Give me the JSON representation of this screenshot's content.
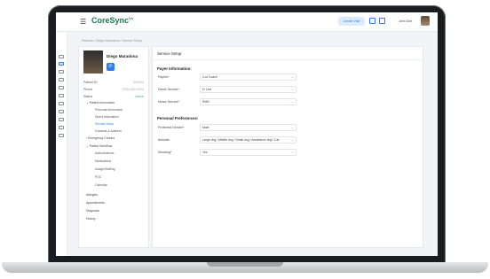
{
  "app": {
    "logo": "CoreSync",
    "logo_sup": "Vs"
  },
  "topbar": {
    "menu_icon": "hamburger-icon",
    "create_label": "Create Visit",
    "user_name": "John Doe"
  },
  "breadcrumb": "Patients / Diego Maradona / Service Setup",
  "patient": {
    "name": "Diego Maradona",
    "fields": [
      {
        "label": "Patient ID",
        "value": "000000"
      },
      {
        "label": "Phone",
        "value": "(555) 000-0000"
      },
      {
        "label": "Status",
        "value": "Active"
      }
    ]
  },
  "nav": [
    {
      "label": "Patient Information",
      "level": 1
    },
    {
      "label": "Personal Information",
      "level": 2
    },
    {
      "label": "Direct Information",
      "level": 2
    },
    {
      "label": "Service Setup",
      "level": 2,
      "active": true
    },
    {
      "label": "Contacts & Address",
      "level": 2
    },
    {
      "label": "Emergency Contact",
      "level": 1
    },
    {
      "label": "Patient Workflow",
      "level": 1
    },
    {
      "label": "Authorizations",
      "level": 2
    },
    {
      "label": "Medications",
      "level": 2
    },
    {
      "label": "Assign/Staffing",
      "level": 2
    },
    {
      "label": "POC",
      "level": 2
    },
    {
      "label": "Calendar",
      "level": 2
    },
    {
      "label": "Allergies",
      "level": 0
    },
    {
      "label": "Appointments",
      "level": 0
    },
    {
      "label": "Diagnosis",
      "level": 0
    },
    {
      "label": "History",
      "level": 0
    }
  ],
  "main": {
    "title": "Service Setup",
    "payer_title": "Payer Information:",
    "payer_fields": [
      {
        "label": "Payers*",
        "value": "Cox Coach"
      },
      {
        "label": "Direct Service*",
        "value": "FI Live"
      },
      {
        "label": "Nurse Service*",
        "value": "RMN"
      }
    ],
    "pref_title": "Personal Preferences:",
    "pref_fields": [
      {
        "label": "Preferred Gender*",
        "value": "Male"
      },
      {
        "label": "Animals",
        "value": "Large dog / Middle dog / Small dog / Assistance dog / Cat"
      },
      {
        "label": "Smoking*",
        "value": "Yes"
      }
    ]
  }
}
